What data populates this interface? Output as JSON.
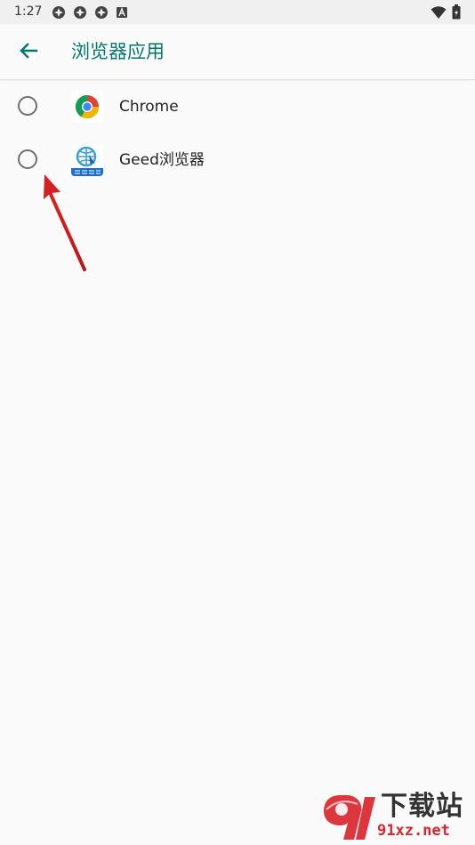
{
  "status_bar": {
    "time": "1:27",
    "left_icons": [
      "notification-app-icon",
      "notification-app-icon",
      "notification-app-icon",
      "text-a-icon"
    ],
    "right_icons": [
      "wifi-icon",
      "battery-icon"
    ]
  },
  "app_bar": {
    "title": "浏览器应用",
    "back_icon": "arrow-left-icon"
  },
  "browsers": [
    {
      "label": "Chrome",
      "icon": "chrome-icon",
      "selected": false
    },
    {
      "label": "Geed浏览器",
      "icon": "geed-browser-icon",
      "selected": false
    }
  ],
  "watermark": {
    "top_text": "下载站",
    "bottom_text": "91xz.net"
  },
  "colors": {
    "accent": "#00796b",
    "annotation_arrow": "#d32020",
    "watermark_red": "#d9262c"
  }
}
